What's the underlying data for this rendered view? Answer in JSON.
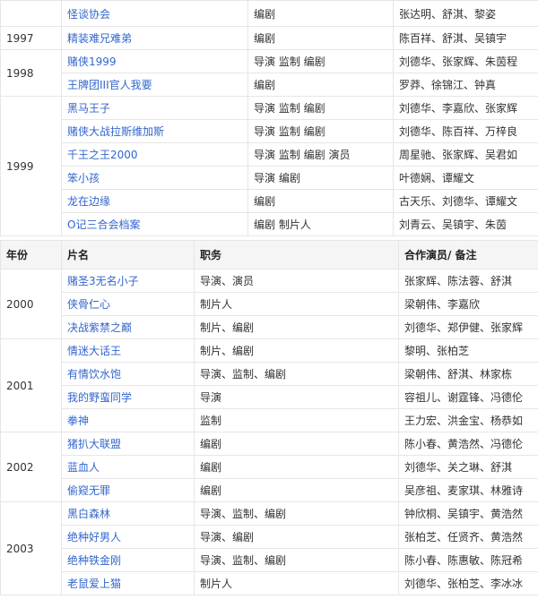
{
  "table_a": {
    "rows": [
      {
        "year": "",
        "title": "怪谈协会",
        "role": "编剧",
        "cast": "张达明、舒淇、黎姿"
      },
      {
        "year": "1997",
        "title": "精装难兄难弟",
        "role": "编剧",
        "cast": "陈百祥、舒淇、吴镇宇"
      },
      {
        "year": "1998",
        "title": "赌侠1999",
        "role": "导演 监制 编剧",
        "cast": "刘德华、张家辉、朱茵程"
      },
      {
        "year": "",
        "title": "王牌团III官人我要",
        "role": "编剧",
        "cast": "罗莽、徐锦江、钟真"
      },
      {
        "year": "1999",
        "title": "黑马王子",
        "role": "导演 监制 编剧",
        "cast": "刘德华、李嘉欣、张家辉"
      },
      {
        "year": "",
        "title": "赌侠大战拉斯维加斯",
        "role": "导演 监制 编剧",
        "cast": "刘德华、陈百祥、万梓良"
      },
      {
        "year": "",
        "title": "千王之王2000",
        "role": "导演 监制 编剧 演员",
        "cast": "周星驰、张家辉、吴君如"
      },
      {
        "year": "",
        "title": "笨小孩",
        "role": "导演 编剧",
        "cast": "叶德娴、谭耀文"
      },
      {
        "year": "",
        "title": "龙在边缘",
        "role": "编剧",
        "cast": "古天乐、刘德华、谭耀文"
      },
      {
        "year": "",
        "title": "O记三合会档案",
        "role": "编剧 制片人",
        "cast": "刘青云、吴镇宇、朱茵"
      }
    ]
  },
  "table_b": {
    "headers": {
      "year": "年份",
      "title": "片名",
      "role": "职务",
      "cast": "合作演员/ 备注"
    },
    "rows": [
      {
        "year": "2000",
        "title": "赌圣3无名小子",
        "role": "导演、演员",
        "cast": "张家辉、陈法蓉、舒淇"
      },
      {
        "year": "",
        "title": "侠骨仁心",
        "role": "制片人",
        "cast": "梁朝伟、李嘉欣"
      },
      {
        "year": "",
        "title": "决战紫禁之巅",
        "role": "制片、编剧",
        "cast": "刘德华、郑伊健、张家辉"
      },
      {
        "year": "2001",
        "title": "情迷大话王",
        "role": "制片、编剧",
        "cast": "黎明、张柏芝"
      },
      {
        "year": "",
        "title": "有情饮水饱",
        "role": "导演、监制、编剧",
        "cast": "梁朝伟、舒淇、林家栋"
      },
      {
        "year": "",
        "title": "我的野蛮同学",
        "role": "导演",
        "cast": "容祖儿、谢霆锋、冯德伦"
      },
      {
        "year": "",
        "title": "拳神",
        "role": "监制",
        "cast": "王力宏、洪金宝、杨恭如"
      },
      {
        "year": "2002",
        "title": "猪扒大联盟",
        "role": "编剧",
        "cast": "陈小春、黄浩然、冯德伦"
      },
      {
        "year": "",
        "title": "蓝血人",
        "role": "编剧",
        "cast": "刘德华、关之琳、舒淇"
      },
      {
        "year": "",
        "title": "偷窥无罪",
        "role": "编剧",
        "cast": "吴彦祖、麦家琪、林雅诗"
      },
      {
        "year": "2003",
        "title": "黑白森林",
        "role": "导演、监制、编剧",
        "cast": "钟欣桐、吴镇宇、黄浩然"
      },
      {
        "year": "",
        "title": "绝种好男人",
        "role": "导演、编剧",
        "cast": "张柏芝、任贤齐、黄浩然"
      },
      {
        "year": "",
        "title": "绝种铁金刚",
        "role": "导演、监制、编剧",
        "cast": "陈小春、陈惠敏、陈冠希"
      },
      {
        "year": "",
        "title": "老鼠爱上猫",
        "role": "制片人",
        "cast": "刘德华、张柏芝、李冰冰"
      }
    ]
  }
}
